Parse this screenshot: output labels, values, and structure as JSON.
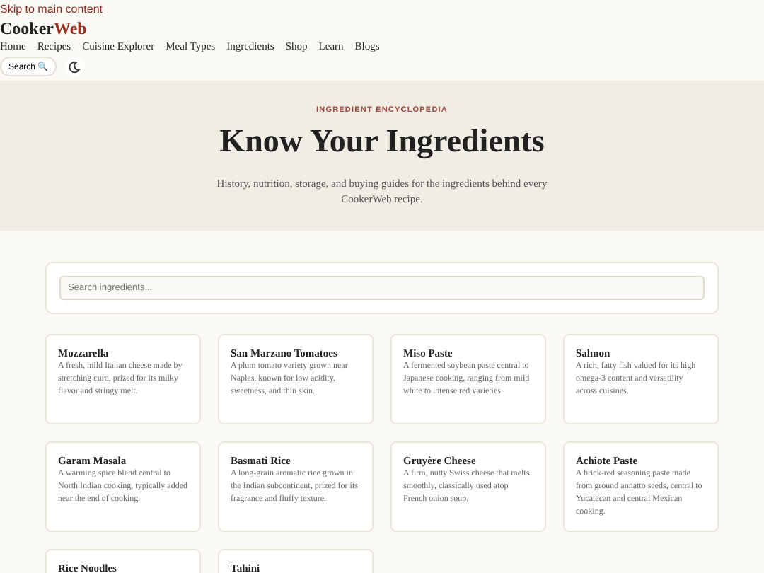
{
  "skip_link": "Skip to main content",
  "logo": {
    "part_1": "Cooker",
    "part_2": "Web"
  },
  "nav": [
    {
      "label": "Home"
    },
    {
      "label": "Recipes"
    },
    {
      "label": "Cuisine Explorer"
    },
    {
      "label": "Meal Types"
    },
    {
      "label": "Ingredients"
    },
    {
      "label": "Shop"
    },
    {
      "label": "Learn"
    },
    {
      "label": "Blogs"
    }
  ],
  "search_button": "Search 🔍",
  "hero": {
    "eyebrow": "INGREDIENT ENCYCLOPEDIA",
    "title": "Know Your Ingredients",
    "description": "History, nutrition, storage, and buying guides for the ingredients behind every CookerWeb recipe."
  },
  "search": {
    "placeholder": "Search ingredients..."
  },
  "ingredients": [
    {
      "name": "Mozzarella",
      "description": "A fresh, mild Italian cheese made by stretching curd, prized for its milky flavor and stringy melt."
    },
    {
      "name": "San Marzano Tomatoes",
      "description": "A plum tomato variety grown near Naples, known for low acidity, sweetness, and thin skin."
    },
    {
      "name": "Miso Paste",
      "description": "A fermented soybean paste central to Japanese cooking, ranging from mild white to intense red varieties."
    },
    {
      "name": "Salmon",
      "description": "A rich, fatty fish valued for its high omega-3 content and versatility across cuisines."
    },
    {
      "name": "Garam Masala",
      "description": "A warming spice blend central to North Indian cooking, typically added near the end of cooking."
    },
    {
      "name": "Basmati Rice",
      "description": "A long-grain aromatic rice grown in the Indian subcontinent, prized for its fragrance and fluffy texture."
    },
    {
      "name": "Gruyère Cheese",
      "description": "A firm, nutty Swiss cheese that melts smoothly, classically used atop French onion soup."
    },
    {
      "name": "Achiote Paste",
      "description": "A brick-red seasoning paste made from ground annatto seeds, central to Yucatecan and central Mexican cooking."
    },
    {
      "name": "Rice Noodles"
    },
    {
      "name": "Tahini"
    }
  ]
}
